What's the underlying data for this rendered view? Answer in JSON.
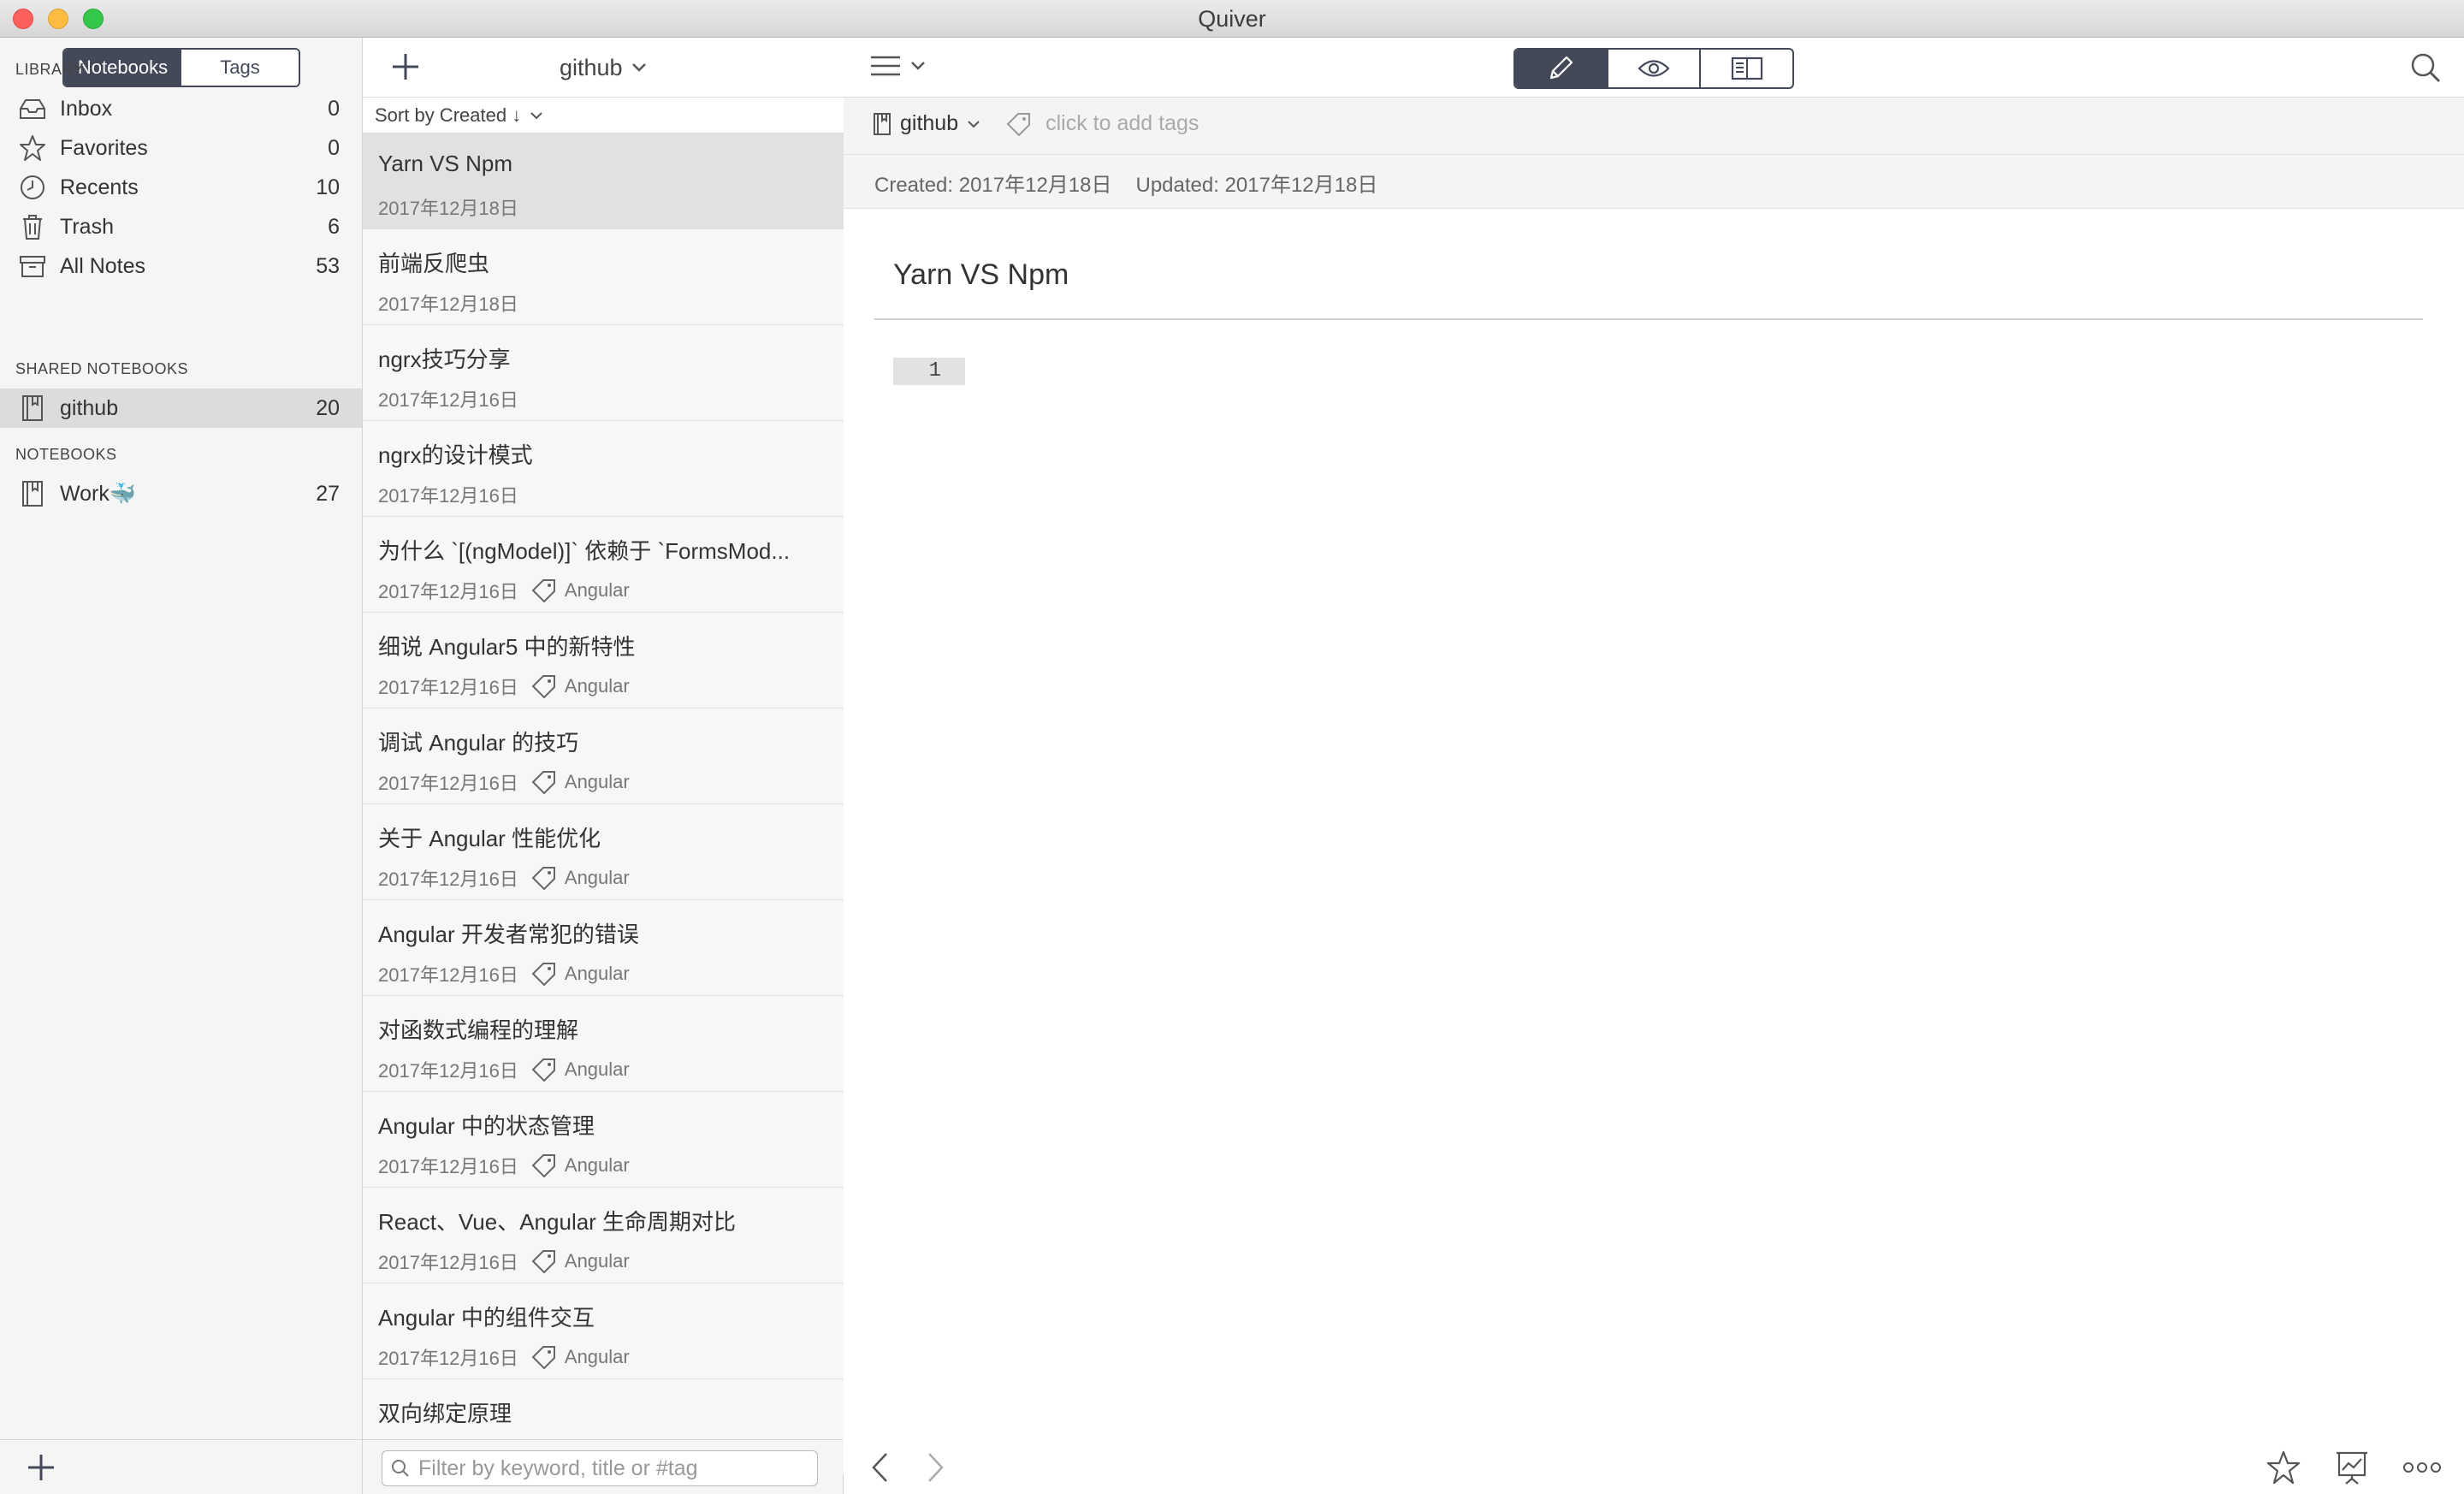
{
  "window": {
    "title": "Quiver"
  },
  "sidebar": {
    "tabs": [
      {
        "label": "Notebooks",
        "active": true
      },
      {
        "label": "Tags",
        "active": false
      }
    ],
    "library_title": "LIBRARY",
    "library": [
      {
        "label": "Inbox",
        "count": "0",
        "icon": "inbox-icon"
      },
      {
        "label": "Favorites",
        "count": "0",
        "icon": "star-icon"
      },
      {
        "label": "Recents",
        "count": "10",
        "icon": "clock-icon"
      },
      {
        "label": "Trash",
        "count": "6",
        "icon": "trash-icon"
      },
      {
        "label": "All Notes",
        "count": "53",
        "icon": "archive-icon"
      }
    ],
    "shared_title": "SHARED NOTEBOOKS",
    "shared": [
      {
        "label": "github",
        "count": "20",
        "selected": true
      }
    ],
    "notebooks_title": "NOTEBOOKS",
    "notebooks": [
      {
        "label": "Work🐳",
        "count": "27"
      }
    ]
  },
  "notelist": {
    "notebook_name": "github",
    "sort_label": "Sort by Created ↓",
    "filter_placeholder": "Filter by keyword, title or #tag",
    "notes": [
      {
        "title": "Yarn VS Npm",
        "date": "2017年12月18日",
        "tag": "",
        "selected": true
      },
      {
        "title": "前端反爬虫",
        "date": "2017年12月18日",
        "tag": ""
      },
      {
        "title": "ngrx技巧分享",
        "date": "2017年12月16日",
        "tag": ""
      },
      {
        "title": "ngrx的设计模式",
        "date": "2017年12月16日",
        "tag": ""
      },
      {
        "title": "为什么 `[(ngModel)]` 依赖于 `FormsMod...",
        "date": "2017年12月16日",
        "tag": "Angular"
      },
      {
        "title": "细说 Angular5 中的新特性",
        "date": "2017年12月16日",
        "tag": "Angular"
      },
      {
        "title": "调试 Angular 的技巧",
        "date": "2017年12月16日",
        "tag": "Angular"
      },
      {
        "title": "关于 Angular 性能优化",
        "date": "2017年12月16日",
        "tag": "Angular"
      },
      {
        "title": "Angular 开发者常犯的错误",
        "date": "2017年12月16日",
        "tag": "Angular"
      },
      {
        "title": "对函数式编程的理解",
        "date": "2017年12月16日",
        "tag": "Angular"
      },
      {
        "title": "Angular 中的状态管理",
        "date": "2017年12月16日",
        "tag": "Angular"
      },
      {
        "title": "React、Vue、Angular 生命周期对比",
        "date": "2017年12月16日",
        "tag": "Angular"
      },
      {
        "title": "Angular 中的组件交互",
        "date": "2017年12月16日",
        "tag": "Angular"
      },
      {
        "title": "双向绑定原理",
        "date": "",
        "tag": ""
      }
    ]
  },
  "editor": {
    "notebook": "github",
    "tags_placeholder": "click to add tags",
    "created": "Created: 2017年12月18日",
    "updated": "Updated: 2017年12月18日",
    "note_title": "Yarn VS Npm",
    "cell_number": "1",
    "active_mode": "edit",
    "accent_color": "#44495a"
  }
}
